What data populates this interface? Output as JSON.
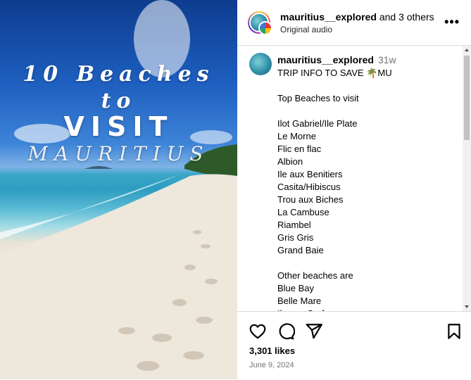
{
  "media": {
    "title_line1": "10 Beaches",
    "title_line2": "to",
    "title_line3": "VISIT",
    "title_line4": "MAURITIUS"
  },
  "header": {
    "username": "mauritius__explored",
    "and_others": " and 3 others",
    "subtitle": "Original audio",
    "more_label": "•••"
  },
  "caption": {
    "username": "mauritius__explored",
    "age": "31w",
    "text": "TRIP INFO TO SAVE 🌴MU\n\nTop Beaches to visit\n\nIlot Gabriel/Ile Plate\nLe Morne\nFlic en flac\nAlbion\nIle aux Benitiers\nCasita/Hibiscus\nTrou aux Biches\nLa Cambuse\nRiambel\nGris Gris\nGrand Baie\n\nOther beaches are\nBlue Bay\nBelle Mare\nIle aux Cerfs"
  },
  "actions": {
    "likes": "3,301 likes",
    "date": "June 9, 2024",
    "icons": [
      "heart-icon",
      "comment-icon",
      "share-icon",
      "bookmark-icon"
    ]
  },
  "colors": {
    "border": "#dbdbdb",
    "muted": "#737373"
  }
}
